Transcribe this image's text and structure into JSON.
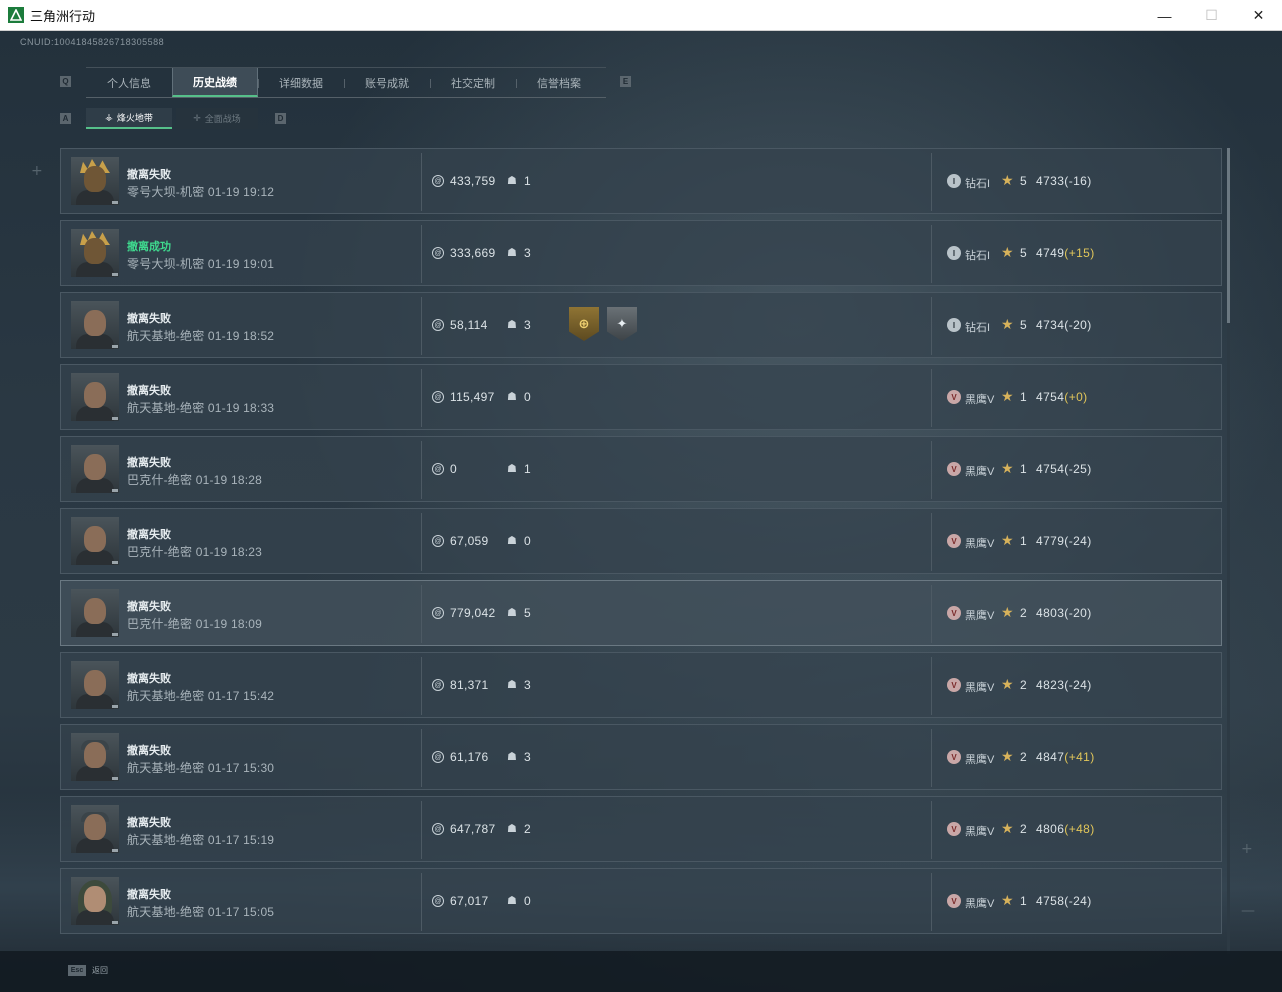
{
  "window": {
    "title": "三角洲行动",
    "minimize_icon": "—",
    "maximize_icon": "☐",
    "close_icon": "✕"
  },
  "uid_text": "CNUID:10041845826718305588",
  "tabs": {
    "left_key": "Q",
    "right_key": "E",
    "items": [
      {
        "label": "个人信息"
      },
      {
        "label": "历史战绩",
        "active": true
      },
      {
        "label": "详细数据"
      },
      {
        "label": "账号成就"
      },
      {
        "label": "社交定制"
      },
      {
        "label": "信誉档案"
      }
    ]
  },
  "subtabs": {
    "left_key": "A",
    "right_key": "D",
    "items": [
      {
        "label": "烽火地带",
        "icon": "⚶",
        "active": true
      },
      {
        "label": "全面战场",
        "icon": "✛"
      }
    ]
  },
  "matches": [
    {
      "result": "撤离失败",
      "win": false,
      "map": "零号大坝-机密 01-19 19:12",
      "value": "433,759",
      "kills": "1",
      "rank_icon": "I",
      "rank_name": "钻石I",
      "rank_type": "diamond",
      "stars": "5",
      "score": "4733",
      "delta": "(-16)",
      "delta_pos": false,
      "avatar": "gold",
      "medals": []
    },
    {
      "result": "撤离成功",
      "win": true,
      "map": "零号大坝-机密 01-19 19:01",
      "value": "333,669",
      "kills": "3",
      "rank_icon": "I",
      "rank_name": "钻石I",
      "rank_type": "diamond",
      "stars": "5",
      "score": "4749",
      "delta": "(+15)",
      "delta_pos": true,
      "avatar": "gold",
      "medals": []
    },
    {
      "result": "撤离失败",
      "win": false,
      "map": "航天基地-绝密 01-19 18:52",
      "value": "58,114",
      "kills": "3",
      "rank_icon": "I",
      "rank_name": "钻石I",
      "rank_type": "diamond",
      "stars": "5",
      "score": "4734",
      "delta": "(-20)",
      "delta_pos": false,
      "avatar": "beard",
      "medals": [
        {
          "type": "gold",
          "glyph": "⊕"
        },
        {
          "type": "silver",
          "glyph": "✦"
        }
      ]
    },
    {
      "result": "撤离失败",
      "win": false,
      "map": "航天基地-绝密 01-19 18:33",
      "value": "115,497",
      "kills": "0",
      "rank_icon": "V",
      "rank_name": "黑鹰V",
      "rank_type": "eagle",
      "stars": "1",
      "score": "4754",
      "delta": "(+0)",
      "delta_pos": true,
      "avatar": "beard",
      "medals": []
    },
    {
      "result": "撤离失败",
      "win": false,
      "map": "巴克什-绝密 01-19 18:28",
      "value": "0",
      "kills": "1",
      "rank_icon": "V",
      "rank_name": "黑鹰V",
      "rank_type": "eagle",
      "stars": "1",
      "score": "4754",
      "delta": "(-25)",
      "delta_pos": false,
      "avatar": "beard",
      "medals": []
    },
    {
      "result": "撤离失败",
      "win": false,
      "map": "巴克什-绝密 01-19 18:23",
      "value": "67,059",
      "kills": "0",
      "rank_icon": "V",
      "rank_name": "黑鹰V",
      "rank_type": "eagle",
      "stars": "1",
      "score": "4779",
      "delta": "(-24)",
      "delta_pos": false,
      "avatar": "beard",
      "medals": []
    },
    {
      "result": "撤离失败",
      "win": false,
      "map": "巴克什-绝密 01-19 18:09",
      "value": "779,042",
      "kills": "5",
      "rank_icon": "V",
      "rank_name": "黑鹰V",
      "rank_type": "eagle",
      "stars": "2",
      "score": "4803",
      "delta": "(-20)",
      "delta_pos": false,
      "avatar": "beard",
      "medals": [],
      "highlight": true
    },
    {
      "result": "撤离失败",
      "win": false,
      "map": "航天基地-绝密 01-17 15:42",
      "value": "81,371",
      "kills": "3",
      "rank_icon": "V",
      "rank_name": "黑鹰V",
      "rank_type": "eagle",
      "stars": "2",
      "score": "4823",
      "delta": "(-24)",
      "delta_pos": false,
      "avatar": "plain",
      "medals": []
    },
    {
      "result": "撤离失败",
      "win": false,
      "map": "航天基地-绝密 01-17 15:30",
      "value": "61,176",
      "kills": "3",
      "rank_icon": "V",
      "rank_name": "黑鹰V",
      "rank_type": "eagle",
      "stars": "2",
      "score": "4847",
      "delta": "(+41)",
      "delta_pos": true,
      "avatar": "cap",
      "medals": []
    },
    {
      "result": "撤离失败",
      "win": false,
      "map": "航天基地-绝密 01-17 15:19",
      "value": "647,787",
      "kills": "2",
      "rank_icon": "V",
      "rank_name": "黑鹰V",
      "rank_type": "eagle",
      "stars": "2",
      "score": "4806",
      "delta": "(+48)",
      "delta_pos": true,
      "avatar": "cap",
      "medals": []
    },
    {
      "result": "撤离失败",
      "win": false,
      "map": "航天基地-绝密 01-17 15:05",
      "value": "67,017",
      "kills": "0",
      "rank_icon": "V",
      "rank_name": "黑鹰V",
      "rank_type": "eagle",
      "stars": "1",
      "score": "4758",
      "delta": "(-24)",
      "delta_pos": false,
      "avatar": "hood",
      "medals": []
    }
  ],
  "footer": {
    "esc_key": "Esc",
    "esc_label": "返回"
  },
  "colors": {
    "accent_green": "#56c08a",
    "win_green": "#3fd98e",
    "positive_delta": "#e1c65a",
    "star_gold": "#d7b25b"
  },
  "icons": {
    "coin": "@",
    "skull": "☗",
    "star": "★"
  }
}
